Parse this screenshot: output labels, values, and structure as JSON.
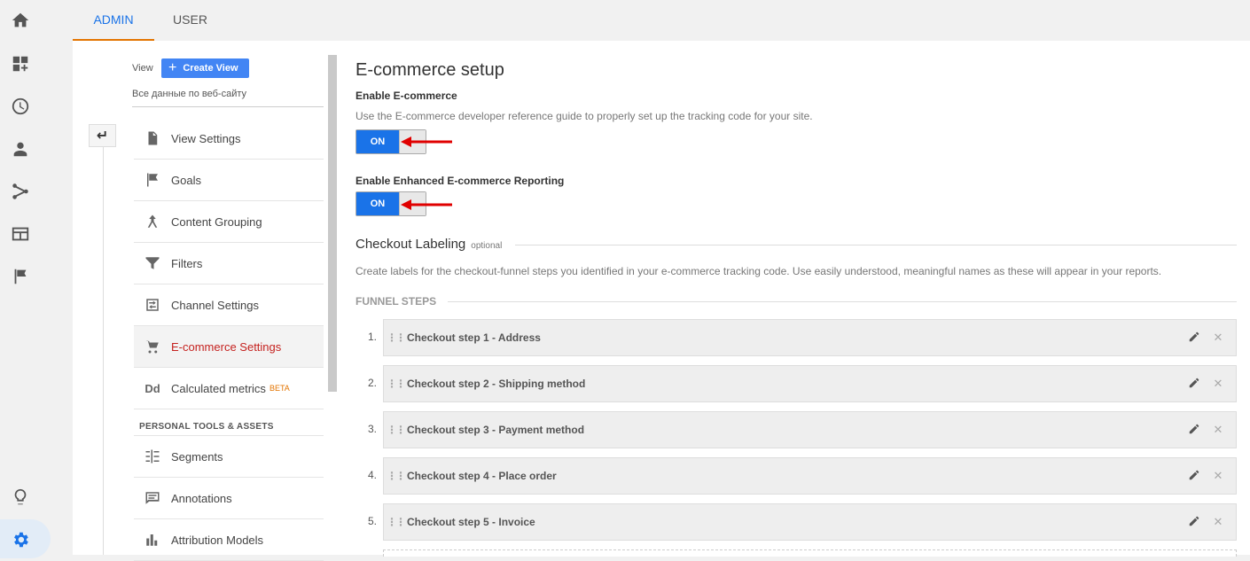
{
  "rail": {
    "icons": [
      "home-icon",
      "dashboard-icon",
      "clock-icon",
      "person-icon",
      "acquisition-icon",
      "behavior-icon",
      "flag-icon"
    ],
    "bottom_icons": [
      "lightbulb-icon",
      "gear-icon"
    ]
  },
  "tabs": [
    {
      "label": "ADMIN",
      "active": true
    },
    {
      "label": "USER",
      "active": false
    }
  ],
  "view": {
    "label": "View",
    "create_button": "Create View",
    "selected": "Все данные по веб-сайту"
  },
  "nav": {
    "items": [
      {
        "label": "View Settings",
        "icon": "document-icon"
      },
      {
        "label": "Goals",
        "icon": "flag-icon"
      },
      {
        "label": "Content Grouping",
        "icon": "grouping-icon"
      },
      {
        "label": "Filters",
        "icon": "filter-icon"
      },
      {
        "label": "Channel Settings",
        "icon": "channel-icon"
      },
      {
        "label": "E-commerce Settings",
        "icon": "cart-icon",
        "active": true
      },
      {
        "label": "Calculated metrics",
        "icon": "dd-icon",
        "badge": "BETA"
      }
    ],
    "section_title": "PERSONAL TOOLS & ASSETS",
    "tools": [
      {
        "label": "Segments",
        "icon": "segments-icon"
      },
      {
        "label": "Annotations",
        "icon": "annotation-icon"
      },
      {
        "label": "Attribution Models",
        "icon": "bar-chart-icon"
      }
    ]
  },
  "content": {
    "title": "E-commerce setup",
    "enable_ecommerce": {
      "label": "Enable E-commerce",
      "description": "Use the E-commerce developer reference guide to properly set up the tracking code for your site.",
      "toggle": "ON"
    },
    "enable_enhanced": {
      "label": "Enable Enhanced E-commerce Reporting",
      "toggle": "ON"
    },
    "checkout": {
      "title": "Checkout Labeling",
      "optional": "optional",
      "description": "Create labels for the checkout-funnel steps you identified in your e-commerce tracking code. Use easily understood, meaningful names as these will appear in your reports.",
      "funnel_heading": "FUNNEL STEPS",
      "steps": [
        {
          "num": "1.",
          "label": "Checkout step 1 - Address"
        },
        {
          "num": "2.",
          "label": "Checkout step 2 - Shipping method"
        },
        {
          "num": "3.",
          "label": "Checkout step 3 - Payment method"
        },
        {
          "num": "4.",
          "label": "Checkout step 4 - Place order"
        },
        {
          "num": "5.",
          "label": "Checkout step 5 - Invoice"
        }
      ]
    }
  },
  "colors": {
    "accent": "#1a73e8",
    "active_tab_underline": "#e37400",
    "active_nav_text": "#c5221f",
    "annotation_arrow": "#e00000"
  }
}
